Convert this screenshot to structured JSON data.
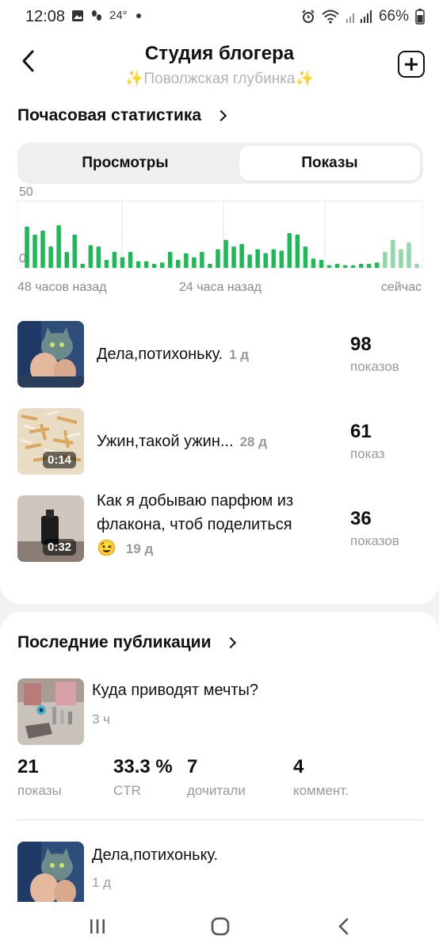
{
  "status_bar": {
    "time": "12:08",
    "temp": "24°",
    "battery": "66%",
    "icons": [
      "gallery-icon",
      "steps-icon",
      "dot-icon",
      "alarm-icon",
      "wifi-icon",
      "signal-icon",
      "battery-icon"
    ]
  },
  "header": {
    "title": "Студия блогера",
    "subtitle": "✨Поволжская глубинка✨",
    "icons": [
      "back-arrow-icon",
      "add-square-icon"
    ]
  },
  "hourly": {
    "title": "Почасовая статистика",
    "tabs": [
      {
        "label": "Просмотры",
        "active": false
      },
      {
        "label": "Показы",
        "active": true
      }
    ],
    "y_top": "50",
    "y_bottom": "0",
    "x_labels": [
      "48 часов назад",
      "24 часа назад",
      "сейчас"
    ],
    "colors": {
      "bar": "#1db954",
      "bar_faded": "#8fd9a8",
      "grid": "#e4e4e4"
    }
  },
  "chart_data": {
    "type": "bar",
    "ylim": [
      0,
      50
    ],
    "values": [
      31,
      25,
      28,
      16,
      32,
      12,
      25,
      3,
      17,
      16,
      6,
      12,
      8,
      12,
      5,
      5,
      3,
      4,
      12,
      6,
      11,
      8,
      12,
      3,
      14,
      21,
      16,
      18,
      10,
      14,
      11,
      14,
      13,
      26,
      25,
      16,
      7,
      6,
      2,
      3,
      2,
      2,
      3,
      3,
      4
    ],
    "faded_values": [
      12,
      21,
      14,
      19,
      3
    ]
  },
  "publications": [
    {
      "title": "Дела,потихоньку.",
      "age": "1 д",
      "count": "98",
      "unit": "показов",
      "duration": ""
    },
    {
      "title": "Ужин,такой ужин...",
      "age": "28 д",
      "count": "61",
      "unit": "показ",
      "duration": "0:14"
    },
    {
      "title": "Как я добываю парфюм из флакона, чтоб поделиться",
      "emoji": "😉",
      "age": "19 д",
      "count": "36",
      "unit": "показов",
      "duration": "0:32"
    }
  ],
  "latest": {
    "title": "Последние публикации",
    "items": [
      {
        "title": "Куда приводят мечты?",
        "age": "3 ч",
        "stats": [
          {
            "value": "21",
            "label": "показы"
          },
          {
            "value": "33.3 %",
            "label": "CTR"
          },
          {
            "value": "7",
            "label": "дочитали"
          },
          {
            "value": "4",
            "label": "коммент."
          }
        ]
      },
      {
        "title": "Дела,потихоньку.",
        "age": "1 д"
      }
    ]
  },
  "nav": {
    "icons": [
      "recent-apps-icon",
      "home-icon",
      "back-icon"
    ]
  }
}
